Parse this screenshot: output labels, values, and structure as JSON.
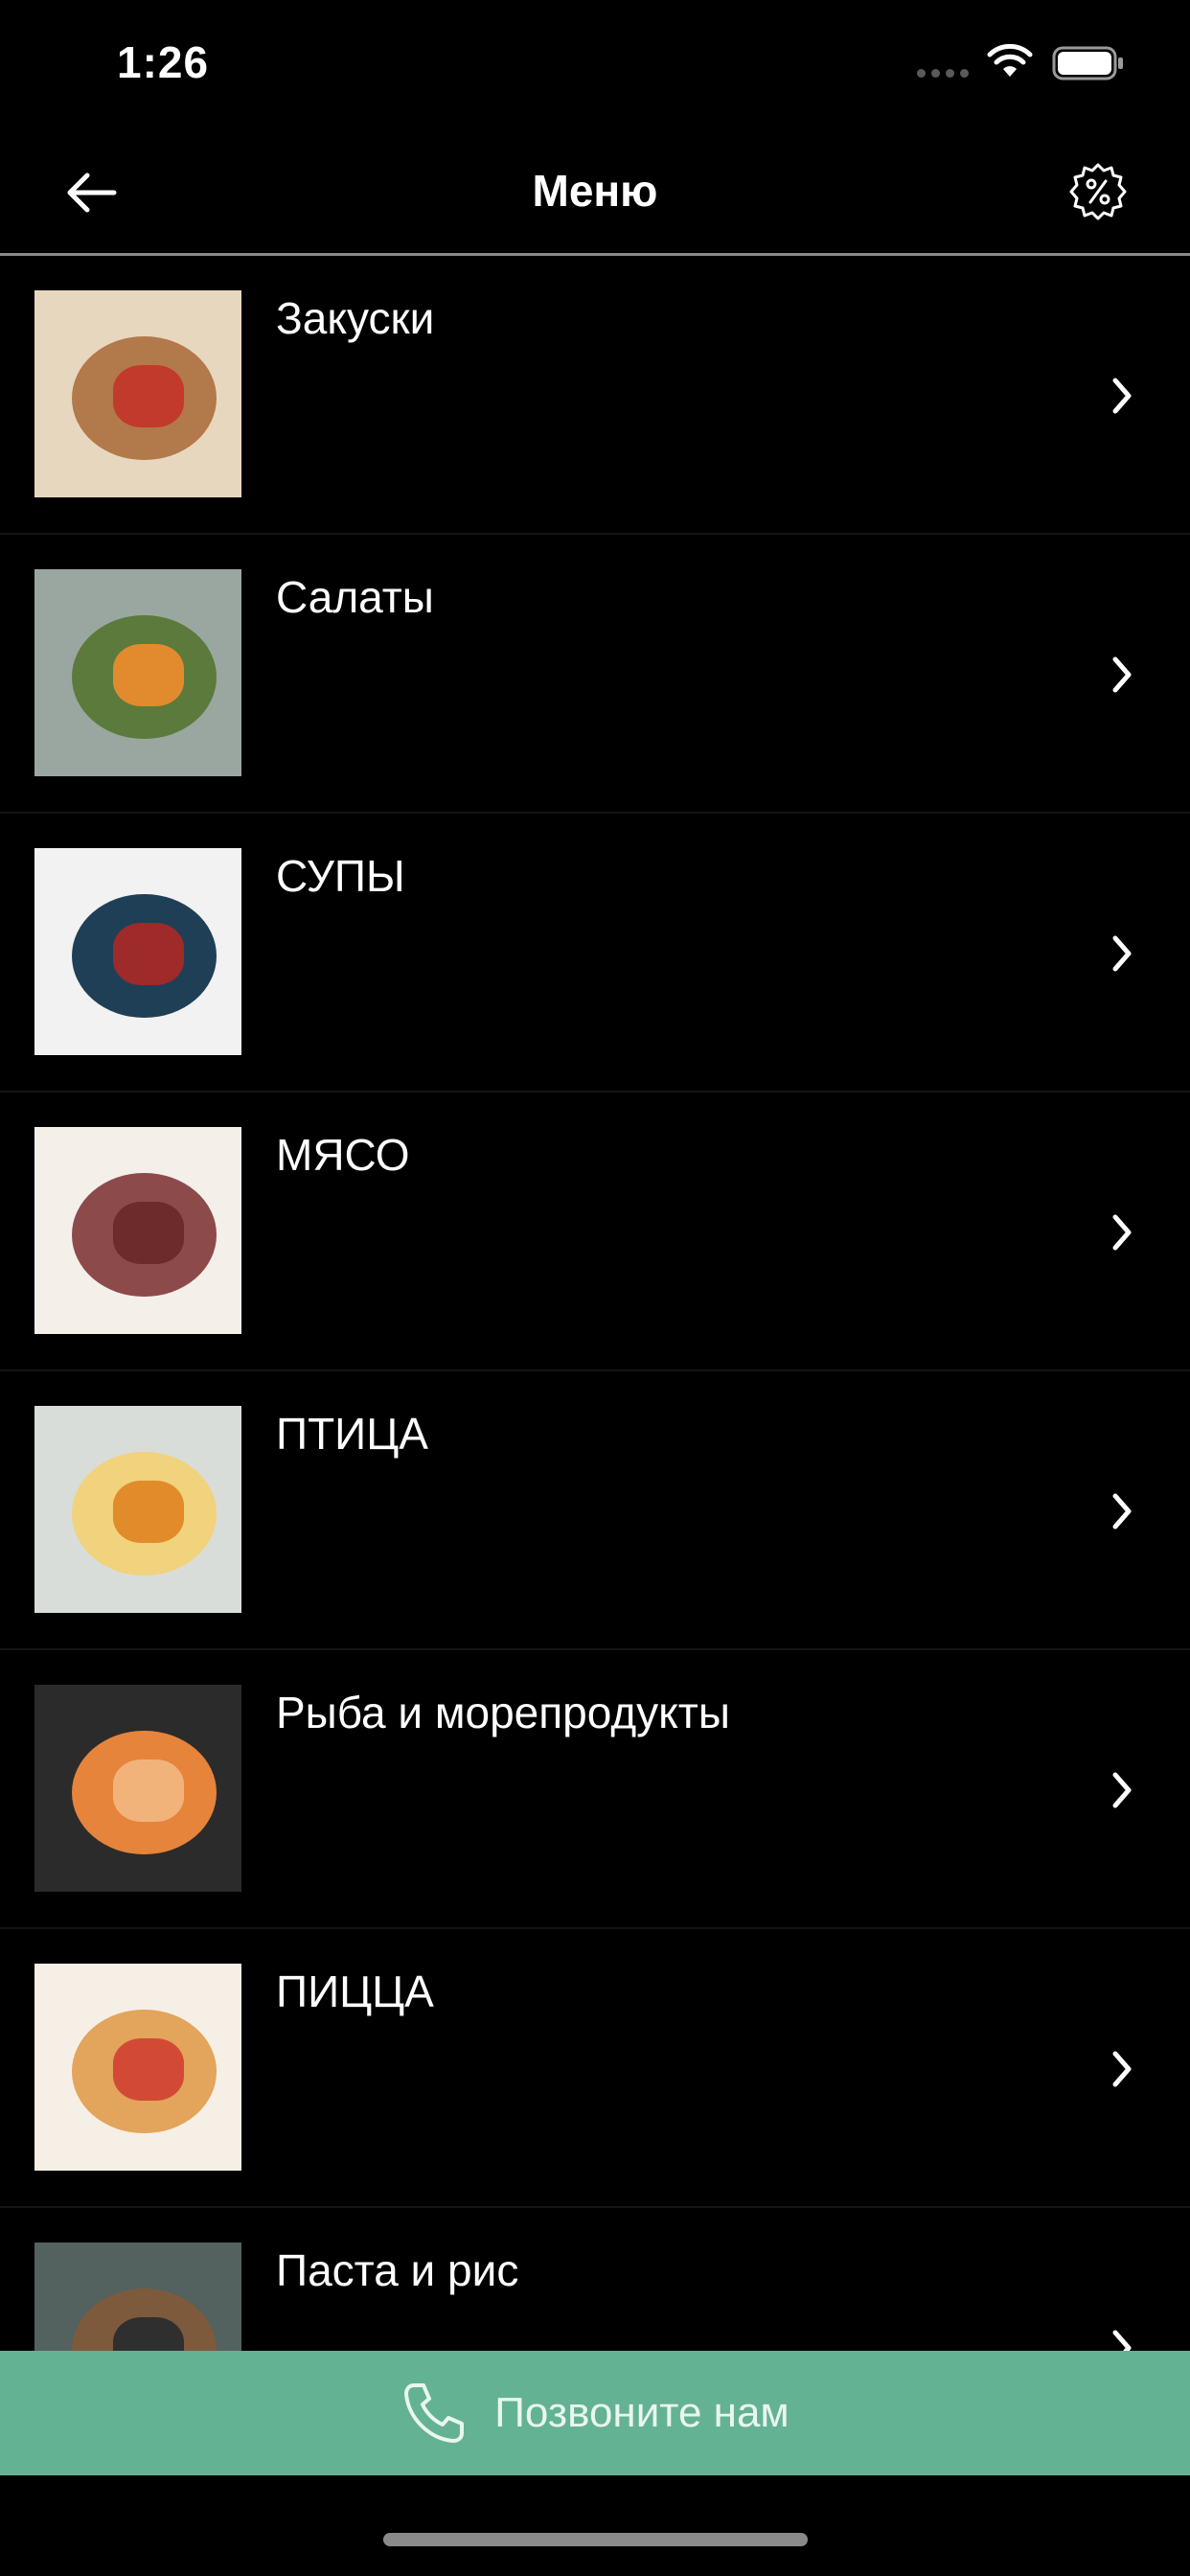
{
  "status": {
    "time": "1:26"
  },
  "nav": {
    "title": "Меню"
  },
  "menu": {
    "items": [
      {
        "label": "Закуски",
        "image": "appetizers-photo",
        "bg": "#e8d7bf",
        "plate": "#b2794a",
        "accent": "#c23a2b"
      },
      {
        "label": "Салаты",
        "image": "salad-photo",
        "bg": "#9aa7a0",
        "plate": "#5b7a3c",
        "accent": "#e28a2e"
      },
      {
        "label": "СУПЫ",
        "image": "soup-photo",
        "bg": "#f2f2f2",
        "plate": "#1f3f56",
        "accent": "#9e2a2a"
      },
      {
        "label": "МЯСО",
        "image": "meat-photo",
        "bg": "#f4efe9",
        "plate": "#8d4a4a",
        "accent": "#6d2b2b"
      },
      {
        "label": "ПТИЦА",
        "image": "poultry-photo",
        "bg": "#d9ddd9",
        "plate": "#f1d27d",
        "accent": "#e28b2a"
      },
      {
        "label": "Рыба и морепродукты",
        "image": "seafood-photo",
        "bg": "#2b2b2b",
        "plate": "#e6843c",
        "accent": "#f2b37b"
      },
      {
        "label": "ПИЦЦА",
        "image": "pizza-photo",
        "bg": "#f6efe6",
        "plate": "#e3a45b",
        "accent": "#d24a35"
      },
      {
        "label": "Паста и рис",
        "image": "pasta-photo",
        "bg": "#53615f",
        "plate": "#7d5a3c",
        "accent": "#2f2f2f"
      }
    ]
  },
  "call": {
    "label": "Позвоните нам"
  },
  "colors": {
    "accent": "#64b294",
    "background": "#000000"
  }
}
